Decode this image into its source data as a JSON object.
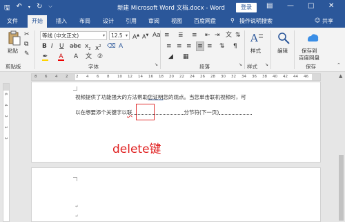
{
  "titlebar": {
    "title": "新建 Microsoft Word 文档.docx - Word",
    "login": "登录",
    "save_icon": "save-icon",
    "undo_icon": "undo-icon",
    "redo_icon": "redo-icon"
  },
  "tabs": [
    "文件",
    "开始",
    "插入",
    "布局",
    "设计",
    "引用",
    "审阅",
    "视图",
    "百度网盘",
    "操作说明搜索"
  ],
  "share": "共享",
  "ribbon": {
    "paste_label": "粘贴",
    "clipboard_label": "剪贴板",
    "font_name": "等线 (中文正文)",
    "font_size": "12.5",
    "font_group_label": "字体",
    "paragraph_group_label": "段落",
    "style_label": "样式",
    "style_group_label": "样式",
    "edit_label": "编辑",
    "save_to_label": "保存到",
    "baidu_label": "百度网盘",
    "save_group_label": "保存"
  },
  "ruler": {
    "h_numbers": [
      "8",
      "6",
      "4",
      "2",
      "2",
      "4",
      "6",
      "8",
      "10",
      "12",
      "14",
      "16",
      "18",
      "20",
      "22",
      "24",
      "26",
      "28",
      "30",
      "32",
      "34",
      "36",
      "38",
      "40",
      "42",
      "44",
      "46"
    ],
    "v_numbers": [
      "6",
      "4",
      "2",
      "1",
      "2"
    ]
  },
  "document": {
    "line1_a": "视频提供了功能强大的方法帮助",
    "line1_b": "您证明",
    "line1_c": "您的观点。当您单击联机视频时，可",
    "line2_a": "以在想要添个关键字以",
    "line2_b": "联",
    "section_break": "分节符(下一页)",
    "annotation": "delete键"
  }
}
